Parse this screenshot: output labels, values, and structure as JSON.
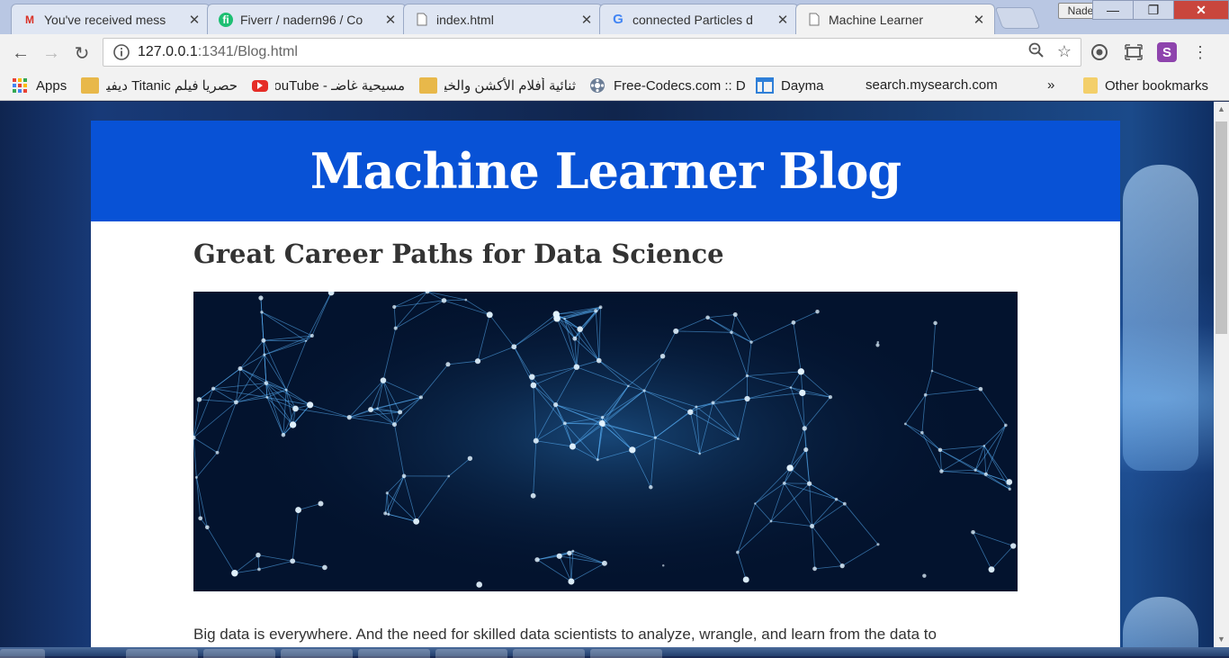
{
  "browser": {
    "tabs": [
      {
        "title": "You've received mess",
        "icon": "gmail-icon",
        "active": false
      },
      {
        "title": "Fiverr / nadern96 / Co",
        "icon": "fiverr-icon",
        "active": false
      },
      {
        "title": "index.html",
        "icon": "page-icon",
        "active": false
      },
      {
        "title": "connected Particles d",
        "icon": "google-icon",
        "active": false
      },
      {
        "title": "Machine Learner",
        "icon": "page-icon",
        "active": true
      }
    ],
    "profile_name": "Nader",
    "address": {
      "host": "127.0.0.1",
      "path": ":1341/Blog.html"
    },
    "bookmarks": [
      {
        "label": "Apps",
        "icon": "apps-grid-icon"
      },
      {
        "label": "حصريا فيلم Titanic ديفيدي",
        "icon": "folder-icon"
      },
      {
        "label": "مسيحية غاضـ - YouTube",
        "icon": "youtube-icon"
      },
      {
        "label": "ثنائية أفلام الأكشن والخيال ال",
        "icon": "folder-icon"
      },
      {
        "label": "Free-Codecs.com :: D",
        "icon": "codecs-icon"
      },
      {
        "label": "Dayma",
        "icon": "dayma-icon"
      },
      {
        "label": "search.mysearch.com",
        "icon": "none"
      }
    ],
    "bookmarks_overflow": "»",
    "other_bookmarks": "Other bookmarks"
  },
  "blog": {
    "banner_title": "Machine Learner Blog",
    "post_title": "Great Career Paths for Data Science",
    "post_text": "Big data is everywhere. And the need for skilled data scientists to analyze, wrangle, and learn from the data to",
    "accent_color": "#0852d6"
  }
}
